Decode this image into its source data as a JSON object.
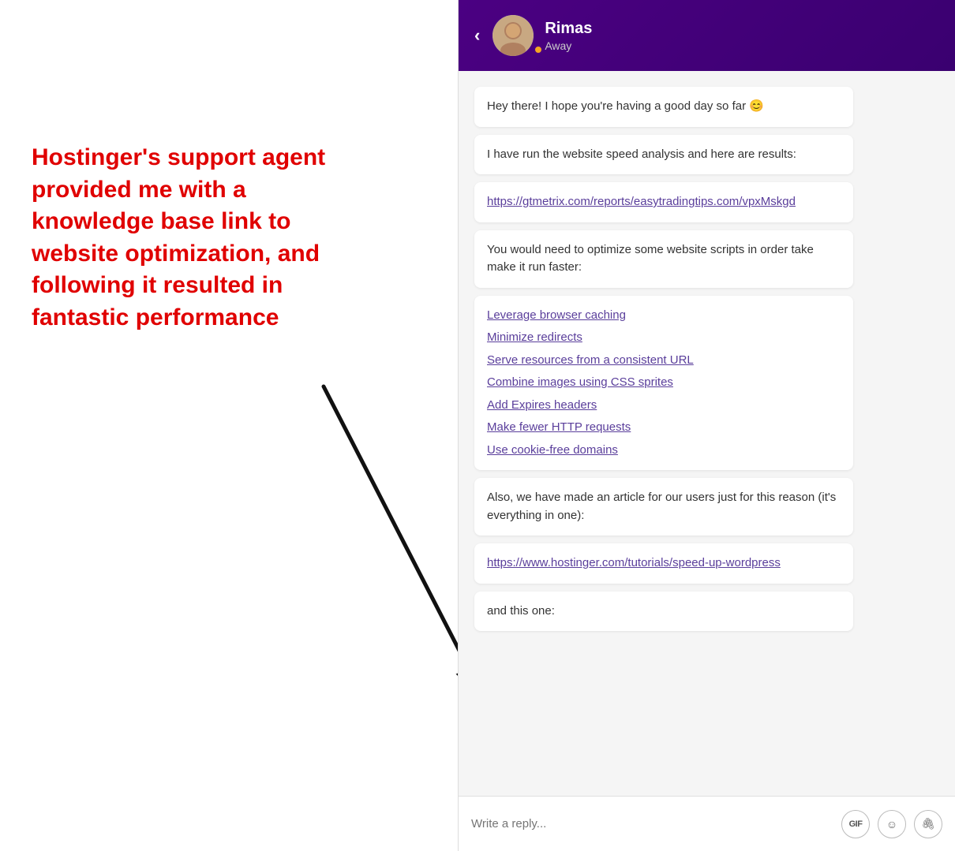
{
  "left_panel": {
    "annotation": "Hostinger's support agent provided me with a knowledge base link to website optimization, and following it resulted in fantastic performance"
  },
  "chat": {
    "header": {
      "back_label": "‹",
      "user_name": "Rimas",
      "user_status": "Away"
    },
    "messages": [
      {
        "id": "msg1",
        "text": "Hey there! I hope you're having a good day so far 😊"
      },
      {
        "id": "msg2",
        "text": "I have run the website speed analysis and here are results:"
      },
      {
        "id": "msg3",
        "type": "link",
        "text": "https://gtmetrix.com/reports/easytradingtips.com/vpxMskgd"
      },
      {
        "id": "msg4",
        "text": "You would need to optimize some website scripts in order take make it run faster:"
      },
      {
        "id": "msg5",
        "type": "links_list",
        "links": [
          "Leverage browser caching",
          "Minimize redirects",
          "Serve resources from a consistent URL",
          "Combine images using CSS sprites",
          "Add Expires headers",
          "Make fewer HTTP requests",
          "Use cookie-free domains"
        ]
      },
      {
        "id": "msg6",
        "text": "Also, we have made an article for our users just for this reason (it's everything in one):"
      },
      {
        "id": "msg7",
        "type": "link",
        "text": "https://www.hostinger.com/tutorials/speed-up-wordpress"
      },
      {
        "id": "msg8",
        "text": "and this one:"
      }
    ],
    "input": {
      "placeholder": "Write a reply...",
      "gif_label": "GIF",
      "emoji_icon": "☺",
      "attach_icon": "📎"
    }
  }
}
